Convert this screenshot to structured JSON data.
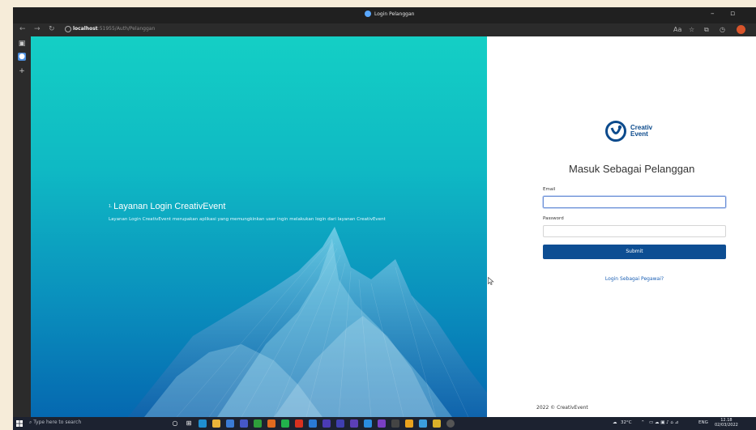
{
  "browser": {
    "tab_title": "Login Pelanggan",
    "url_host": "localhost",
    "url_rest": ":51955/Auth/Pelanggan"
  },
  "hero": {
    "number": "1.",
    "title": "Layanan Login CreativEvent",
    "description": "Layanan Login CreativEvent merupakan aplikasi yang memungkinkan user ingin melakukan login dari layanan CreativEvent"
  },
  "logo": {
    "line1": "Creativ",
    "line2": "Event",
    "color": "#0b4a8c"
  },
  "form": {
    "heading": "Masuk Sebagai Pelanggan",
    "email_label": "Email",
    "email_value": "",
    "password_label": "Password",
    "password_value": "",
    "submit_label": "Submit",
    "alt_login_link": "Login Sebagai Pegawai?"
  },
  "footer": {
    "text": "2022 © CreativEvent"
  },
  "taskbar": {
    "search_placeholder": "Type here to search",
    "weather": "32°C",
    "language": "ENG",
    "time": "12.18",
    "date": "02/03/2022"
  },
  "colors": {
    "accent": "#0d4e93",
    "hero_top": "#14cfc5",
    "hero_bottom": "#0568b0"
  }
}
